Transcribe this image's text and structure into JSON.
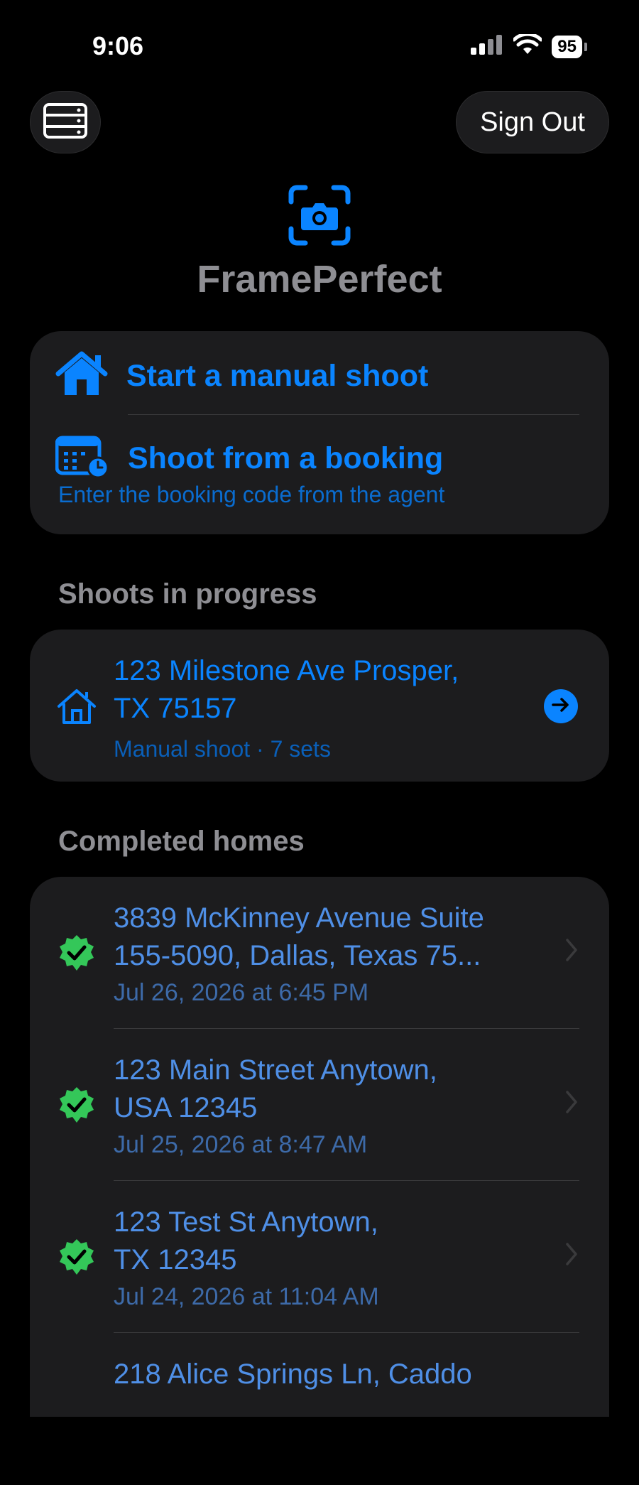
{
  "status": {
    "time": "9:06",
    "battery": "95"
  },
  "header": {
    "sign_out_label": "Sign Out",
    "menu_icon": "server-rack-icon"
  },
  "app": {
    "title": "FramePerfect",
    "logo_icon": "camera-viewfinder-icon"
  },
  "actions": {
    "manual_label": "Start a manual shoot",
    "booking_label": "Shoot from a booking",
    "booking_sub": "Enter the booking code from the agent"
  },
  "in_progress": {
    "header": "Shoots in progress",
    "items": [
      {
        "address_line1": "123 Milestone Ave Prosper,",
        "address_line2": "TX 75157",
        "subtitle": "Manual shoot · 7 sets"
      }
    ]
  },
  "completed": {
    "header": "Completed homes",
    "items": [
      {
        "address_line1": "3839 McKinney Avenue Suite",
        "address_line2": "155-5090, Dallas, Texas 75...",
        "date": "Jul 26, 2026 at 6:45 PM"
      },
      {
        "address_line1": "123 Main Street Anytown,",
        "address_line2": "USA 12345",
        "date": "Jul 25, 2026 at 8:47 AM"
      },
      {
        "address_line1": "123 Test St Anytown,",
        "address_line2": "TX 12345",
        "date": "Jul 24, 2026 at 11:04 AM"
      },
      {
        "address_line1": "218 Alice Springs Ln, Caddo",
        "address_line2": "",
        "date": ""
      }
    ]
  },
  "colors": {
    "accent": "#0a84ff",
    "success": "#34c759",
    "card": "#1c1c1e",
    "muted": "#8e8e93"
  }
}
